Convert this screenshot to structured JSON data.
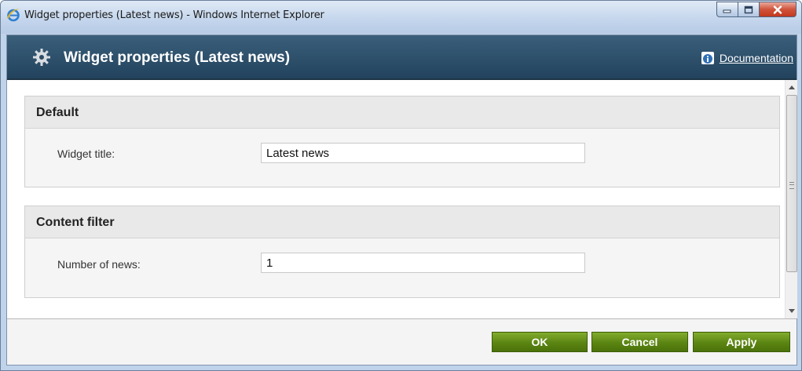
{
  "window": {
    "title": "Widget properties (Latest news) - Windows Internet Explorer",
    "browser_icon": "ie-icon",
    "controls": [
      "minimize-icon",
      "maximize-icon",
      "close-icon"
    ]
  },
  "header": {
    "title": "Widget properties (Latest news)",
    "icon": "gear-icon",
    "documentation_label": "Documentation",
    "documentation_icon": "info-icon"
  },
  "sections": [
    {
      "title": "Default",
      "fields": [
        {
          "label": "Widget title:",
          "value": "Latest news"
        }
      ]
    },
    {
      "title": "Content filter",
      "fields": [
        {
          "label": "Number of news:",
          "value": "1"
        }
      ]
    }
  ],
  "footer": {
    "ok_label": "OK",
    "cancel_label": "Cancel",
    "apply_label": "Apply"
  },
  "colors": {
    "header_bg": "#2f5069",
    "button_green": "#5b8512",
    "section_head_bg": "#e9e9e9"
  }
}
